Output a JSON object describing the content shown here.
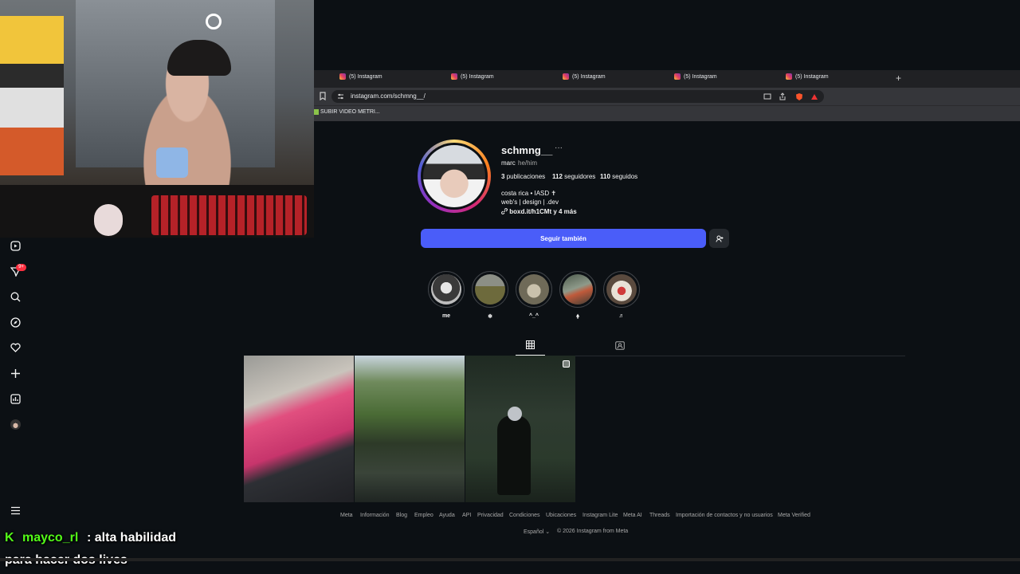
{
  "browser": {
    "tabs": [
      {
        "label": "(5) Instagram"
      },
      {
        "label": "(5) Instagram"
      },
      {
        "label": "(5) Instagram"
      },
      {
        "label": "(5) Instagram"
      },
      {
        "label": "(5) Instagram"
      }
    ],
    "new_tab": "+",
    "url": "instagram.com/schmng__/",
    "bookmark": "SUBIR VIDEO METRI..."
  },
  "sidebar": {
    "notification_badge": "9+",
    "icons": [
      "reels-icon",
      "messages-icon",
      "search-icon",
      "explore-icon",
      "heart-icon",
      "create-icon",
      "dashboard-icon",
      "profile-avatar",
      "menu-icon"
    ]
  },
  "profile": {
    "username": "schmng__",
    "more": "···",
    "full_name": "marc",
    "pronouns": "he/him",
    "posts_count": "3",
    "posts_label": "publicaciones",
    "followers_count": "112",
    "followers_label": "seguidores",
    "following_count": "110",
    "following_label": "seguidos",
    "bio": [
      "costa rica • IASD ✝",
      "web's | design | .dev"
    ],
    "link": "boxd.it/h1CMt y 4 más",
    "follow_button": "Seguir también",
    "suggest_icon": "add-person-icon"
  },
  "highlights": [
    {
      "label": "me"
    },
    {
      "label": "❄"
    },
    {
      "label": "^_^"
    },
    {
      "label": "🠝"
    },
    {
      "label": "♬"
    }
  ],
  "tabs": {
    "posts_icon": "grid-icon",
    "tagged_icon": "tagged-icon"
  },
  "footer": {
    "links": [
      "Meta",
      "Información",
      "Blog",
      "Empleo",
      "Ayuda",
      "API",
      "Privacidad",
      "Condiciones",
      "Ubicaciones",
      "Instagram Lite",
      "Meta AI",
      "Threads",
      "Importación de contactos y no usuarios",
      "Meta Verified"
    ],
    "language": "Español",
    "copyright": "© 2026 Instagram from Meta"
  },
  "chat": {
    "username": "mayco_rl",
    "message_line1": ": alta habilidad",
    "message_line2": "para hacer dos lives"
  },
  "colors": {
    "follow_button": "#4a5df9",
    "background": "#0c1014",
    "chat_username": "#53fc18",
    "badge": "#ff3040"
  }
}
